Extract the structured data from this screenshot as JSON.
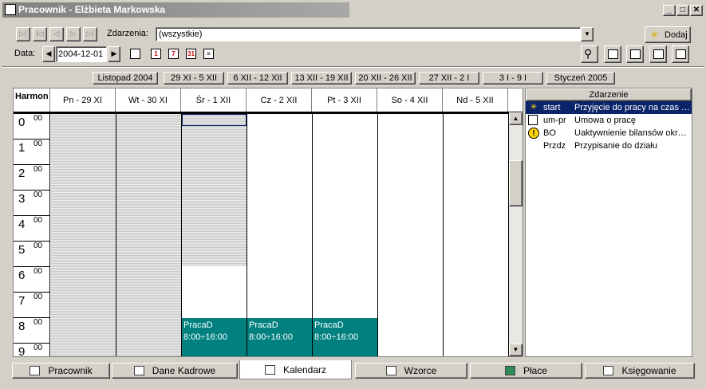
{
  "window": {
    "title": "Pracownik - Elżbieta Markowska",
    "min_symbol": "_",
    "max_symbol": "□",
    "close_symbol": "✕"
  },
  "toolbar": {
    "nav_buttons": [
      "▷|",
      "|◁",
      "◁",
      "▷",
      "▷|"
    ],
    "events_label": "Zdarzenia:",
    "events_value": "(wszystkie)",
    "add_label": "Dodaj",
    "date_label": "Data:",
    "date_value": "2004-12-01",
    "prev_symbol": "◀",
    "next_symbol": "▶"
  },
  "week_buttons": [
    "Listopad 2004",
    "29 XI - 5 XII",
    "6 XII - 12 XII",
    "13 XII - 19 XII",
    "20 XII - 26 XII",
    "27 XII - 2 I",
    "3 I - 9 I",
    "Styczeń 2005"
  ],
  "calendar": {
    "corner_label": "Harmon",
    "days": [
      "Pn - 29 XI",
      "Wt - 30 XI",
      "Śr - 1 XII",
      "Cz - 2 XII",
      "Pt - 3 XII",
      "So - 4 XII",
      "Nd - 5 XII"
    ],
    "hours": [
      "0",
      "1",
      "2",
      "3",
      "4",
      "5",
      "6",
      "7",
      "8",
      "9"
    ],
    "minutes_label": "00",
    "events": [
      {
        "title": "PracaD",
        "time": "8:00÷16:00"
      },
      {
        "title": "PracaD",
        "time": "8:00÷16:00"
      },
      {
        "title": "PracaD",
        "time": "8:00÷16:00"
      }
    ]
  },
  "events_panel": {
    "header": "Zdarzenie",
    "rows": [
      {
        "icon": "star-icon",
        "code": "start",
        "desc": "Przyjęcie do pracy na czas ni...",
        "selected": true
      },
      {
        "icon": "document-icon",
        "code": "um-pr",
        "desc": "Umowa o pracę",
        "selected": false
      },
      {
        "icon": "warning-icon",
        "code": "BO",
        "desc": "Uaktywnienie bilansów okres...",
        "selected": false
      },
      {
        "icon": "",
        "code": "Przdz",
        "desc": "Przypisanie do działu",
        "selected": false
      }
    ]
  },
  "tabs": [
    {
      "label": "Pracownik",
      "active": false
    },
    {
      "label": "Dane Kadrowe",
      "active": false
    },
    {
      "label": "Kalendarz",
      "active": true
    },
    {
      "label": "Wzorce",
      "active": false
    },
    {
      "label": "Płace",
      "active": false
    },
    {
      "label": "Księgowanie",
      "active": false
    }
  ],
  "colors": {
    "event_fill": "#00807f",
    "selection": "#0a246a"
  }
}
